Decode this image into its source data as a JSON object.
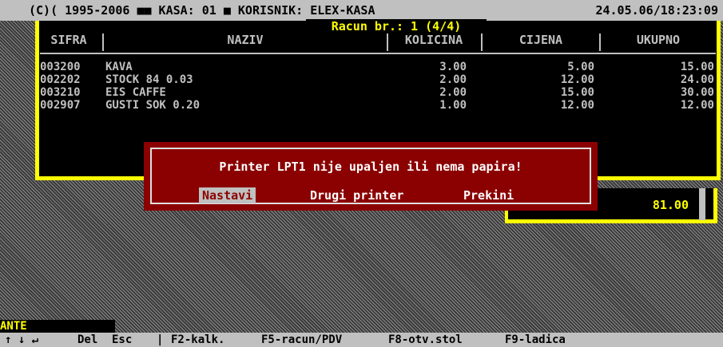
{
  "topbar": {
    "left_text": "(C)( 1995-2006 ■■ KASA: 01 ■ KORISNIK: ELEX-KASA",
    "datetime": "24.05.06/18:23:09"
  },
  "receipt": {
    "title": "Racun br.: 1 (4/4)",
    "columns": [
      "SIFRA",
      "NAZIV",
      "KOLICINA",
      "CIJENA",
      "UKUPNO"
    ],
    "rows": [
      {
        "sifra": "003200",
        "naziv": "KAVA",
        "kolicina": "3.00",
        "cijena": "5.00",
        "ukupno": "15.00"
      },
      {
        "sifra": "002202",
        "naziv": "STOCK 84 0.03",
        "kolicina": "2.00",
        "cijena": "12.00",
        "ukupno": "24.00"
      },
      {
        "sifra": "003210",
        "naziv": "EIS CAFFE",
        "kolicina": "2.00",
        "cijena": "15.00",
        "ukupno": "30.00"
      },
      {
        "sifra": "002907",
        "naziv": "GUSTI SOK 0.20",
        "kolicina": "1.00",
        "cijena": "12.00",
        "ukupno": "12.00"
      }
    ],
    "total": "81.00"
  },
  "dialog": {
    "message": "Printer LPT1 nije upaljen ili nema papira!",
    "buttons": [
      "Nastavi",
      "Drugi printer",
      "Prekini"
    ],
    "selected": "Nastavi"
  },
  "status": {
    "user": "ANTE"
  },
  "bottombar": {
    "arrows": "↑ ↓ ↵",
    "del": "Del",
    "esc": "Esc",
    "sep": "|",
    "f2": "F2-kalk.",
    "f5": "F5-racun/PDV",
    "f8": "F8-otv.stol",
    "f9": "F9-ladica"
  },
  "colors": {
    "frame": "#ffff00",
    "dialog_bg": "#8b0000",
    "bar_bg": "#c0c0c0",
    "text": "#c0c0c0"
  }
}
